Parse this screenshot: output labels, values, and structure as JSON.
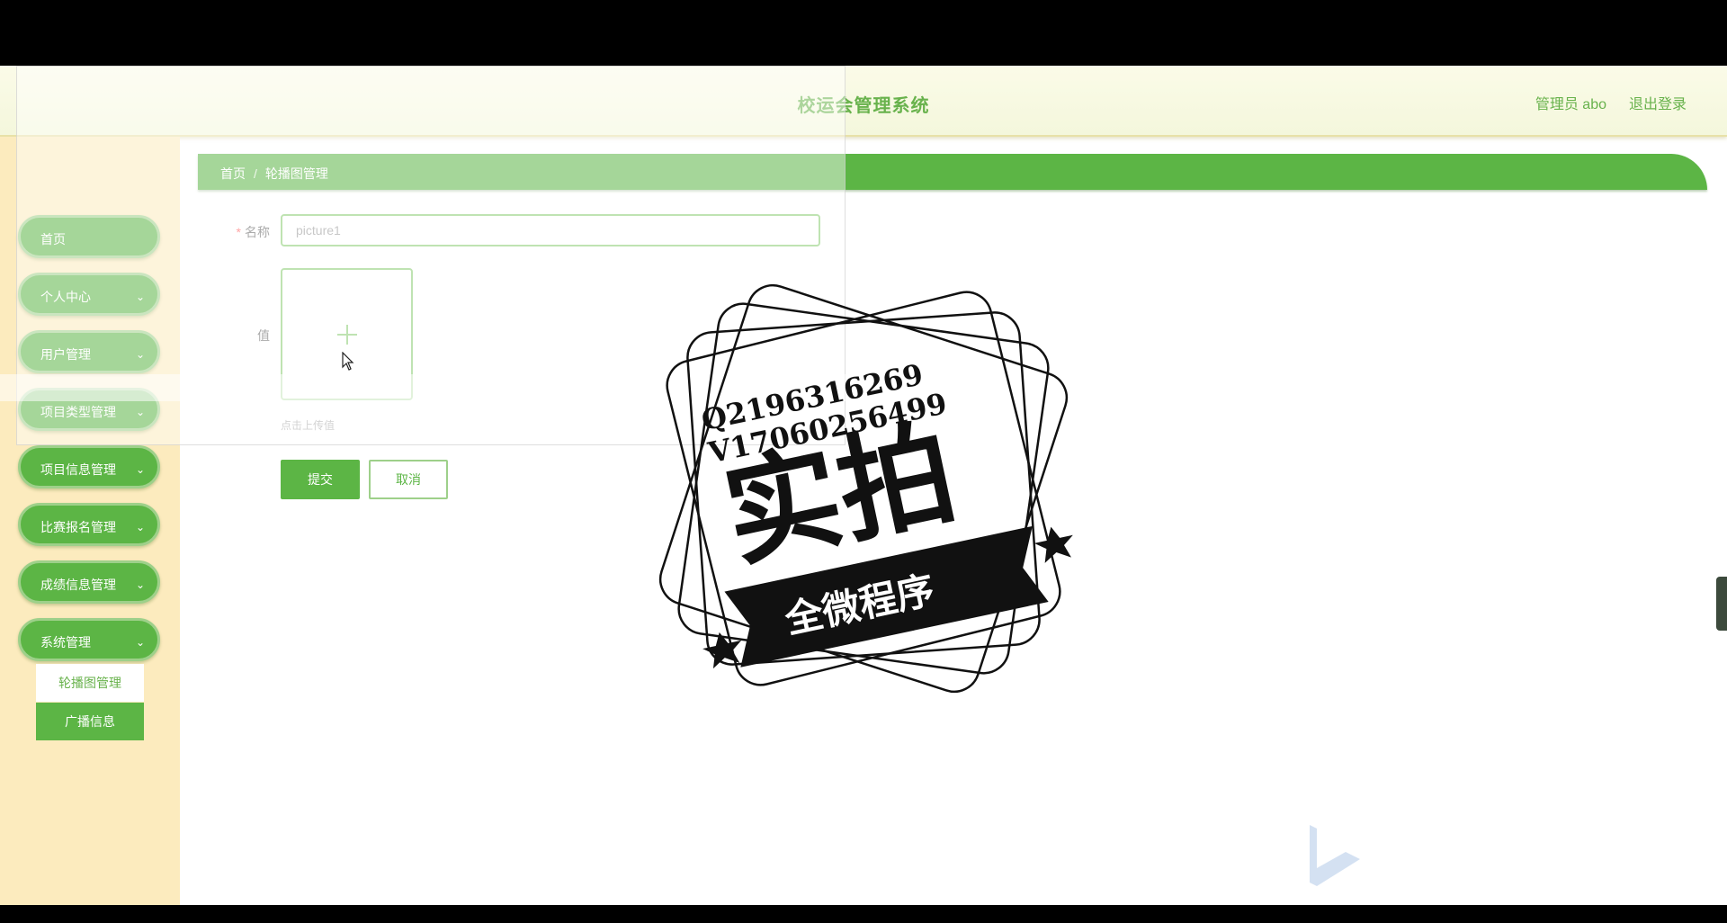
{
  "header": {
    "title": "校运会管理系统",
    "user": "管理员 abo",
    "logout": "退出登录"
  },
  "sidebar": {
    "items": [
      {
        "label": "首页",
        "has_children": false
      },
      {
        "label": "个人中心",
        "has_children": true
      },
      {
        "label": "用户管理",
        "has_children": true
      },
      {
        "label": "项目类型管理",
        "has_children": true
      },
      {
        "label": "项目信息管理",
        "has_children": true
      },
      {
        "label": "比赛报名管理",
        "has_children": true
      },
      {
        "label": "成绩信息管理",
        "has_children": true
      },
      {
        "label": "系统管理",
        "has_children": true,
        "expanded": true
      }
    ],
    "sub_items": [
      {
        "label": "轮播图管理"
      },
      {
        "label": "广播信息"
      }
    ]
  },
  "breadcrumb": {
    "home": "首页",
    "separator": "/",
    "current": "轮播图管理"
  },
  "form": {
    "name_label": "名称",
    "name_required_mark": "*",
    "name_value": "picture1",
    "value_label": "值",
    "upload_hint": "点击上传值",
    "submit": "提交",
    "cancel": "取消"
  },
  "watermark": {
    "line1": "Q2196316269",
    "line2": "V17060256499",
    "big": "实拍",
    "ribbon": "全微程序"
  },
  "colors": {
    "primary": "#5cb545",
    "sidebar_bg": "#fcebbe",
    "header_bg": "#f4f7dc",
    "accent_text": "#68b24c"
  },
  "icons": {
    "menu_expand": "chevron-down-icon",
    "upload": "plus-icon",
    "cursor": "mouse-pointer-icon"
  }
}
